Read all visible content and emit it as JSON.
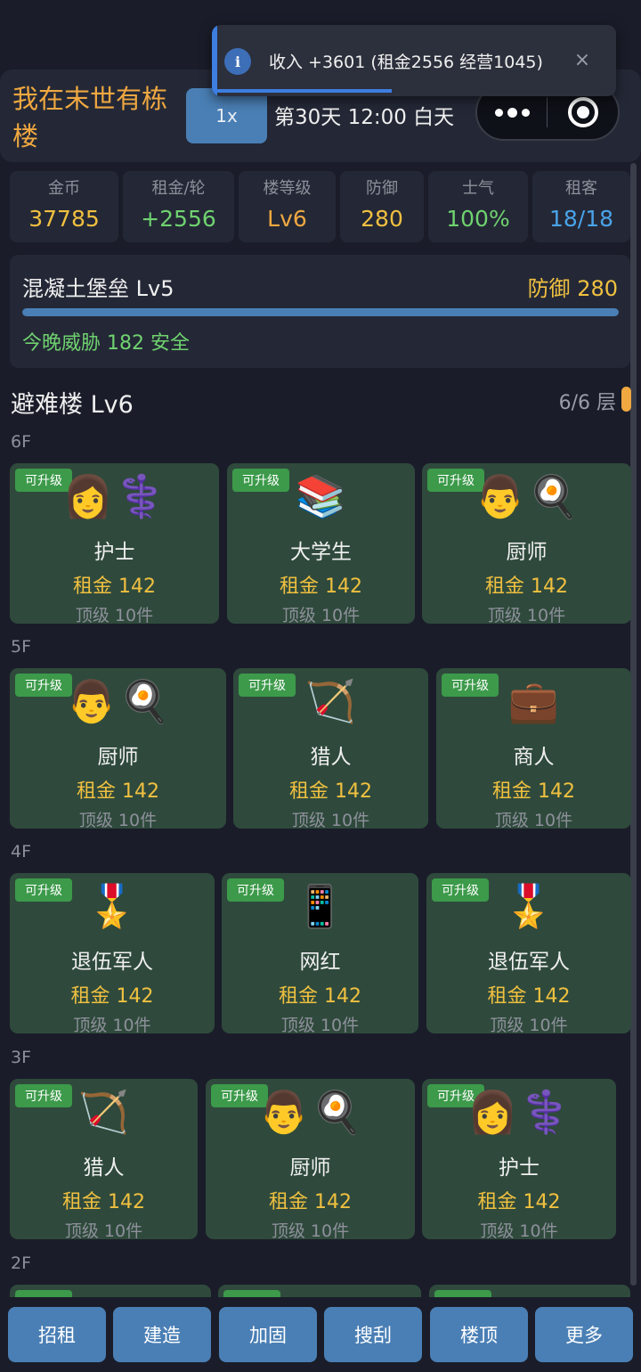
{
  "header": {
    "title": "我在末世有栋楼",
    "speed": "1x",
    "day_text": "第30天 12:00 白天"
  },
  "toast": {
    "icon": "i",
    "text": "收入 +3601 (租金2556 经营1045)",
    "close": "×"
  },
  "stats": [
    {
      "label": "金币",
      "value": "37785",
      "color": "#f0c040"
    },
    {
      "label": "租金/轮",
      "value": "+2556",
      "color": "#6fd26f"
    },
    {
      "label": "楼等级",
      "value": "Lv6",
      "color": "#f0a840"
    },
    {
      "label": "防御",
      "value": "280",
      "color": "#f0c040"
    },
    {
      "label": "士气",
      "value": "100%",
      "color": "#6fd26f"
    },
    {
      "label": "租客",
      "value": "18/18",
      "color": "#4aa3e8"
    }
  ],
  "defense": {
    "name": "混凝土堡垒 Lv5",
    "value": "防御 280",
    "fill_fraction": 1.0,
    "threat": "今晚威胁 182 安全"
  },
  "shelter": {
    "title": "避难楼 Lv6",
    "floor_count": "6/6 层"
  },
  "floors": [
    {
      "label": "6F",
      "rooms": [
        {
          "badge": "可升级",
          "icons": [
            "👩",
            "⚕️"
          ],
          "name": "护士",
          "rent": "租金 142",
          "tier": "顶级 10件"
        },
        {
          "badge": "可升级",
          "icons": [
            "📚"
          ],
          "name": "大学生",
          "rent": "租金 142",
          "tier": "顶级 10件"
        },
        {
          "badge": "可升级",
          "icons": [
            "👨",
            "🍳"
          ],
          "name": "厨师",
          "rent": "租金 142",
          "tier": "顶级 10件"
        }
      ]
    },
    {
      "label": "5F",
      "rooms": [
        {
          "badge": "可升级",
          "icons": [
            "👨",
            "🍳"
          ],
          "name": "厨师",
          "rent": "租金 142",
          "tier": "顶级 10件"
        },
        {
          "badge": "可升级",
          "icons": [
            "🏹"
          ],
          "name": "猎人",
          "rent": "租金 142",
          "tier": "顶级 10件"
        },
        {
          "badge": "可升级",
          "icons": [
            "💼"
          ],
          "name": "商人",
          "rent": "租金 142",
          "tier": "顶级 10件"
        }
      ]
    },
    {
      "label": "4F",
      "rooms": [
        {
          "badge": "可升级",
          "icons": [
            "🎖️"
          ],
          "name": "退伍军人",
          "rent": "租金 142",
          "tier": "顶级 10件"
        },
        {
          "badge": "可升级",
          "icons": [
            "📱"
          ],
          "name": "网红",
          "rent": "租金 142",
          "tier": "顶级 10件"
        },
        {
          "badge": "可升级",
          "icons": [
            "🎖️"
          ],
          "name": "退伍军人",
          "rent": "租金 142",
          "tier": "顶级 10件"
        }
      ]
    },
    {
      "label": "3F",
      "rooms": [
        {
          "badge": "可升级",
          "icons": [
            "🏹"
          ],
          "name": "猎人",
          "rent": "租金 142",
          "tier": "顶级 10件"
        },
        {
          "badge": "可升级",
          "icons": [
            "👨",
            "🍳"
          ],
          "name": "厨师",
          "rent": "租金 142",
          "tier": "顶级 10件"
        },
        {
          "badge": "可升级",
          "icons": [
            "👩",
            "⚕️"
          ],
          "name": "护士",
          "rent": "租金 142",
          "tier": "顶级 10件"
        }
      ]
    },
    {
      "label": "2F",
      "rooms": []
    }
  ],
  "nav": [
    "招租",
    "建造",
    "加固",
    "搜刮",
    "楼顶",
    "更多"
  ]
}
